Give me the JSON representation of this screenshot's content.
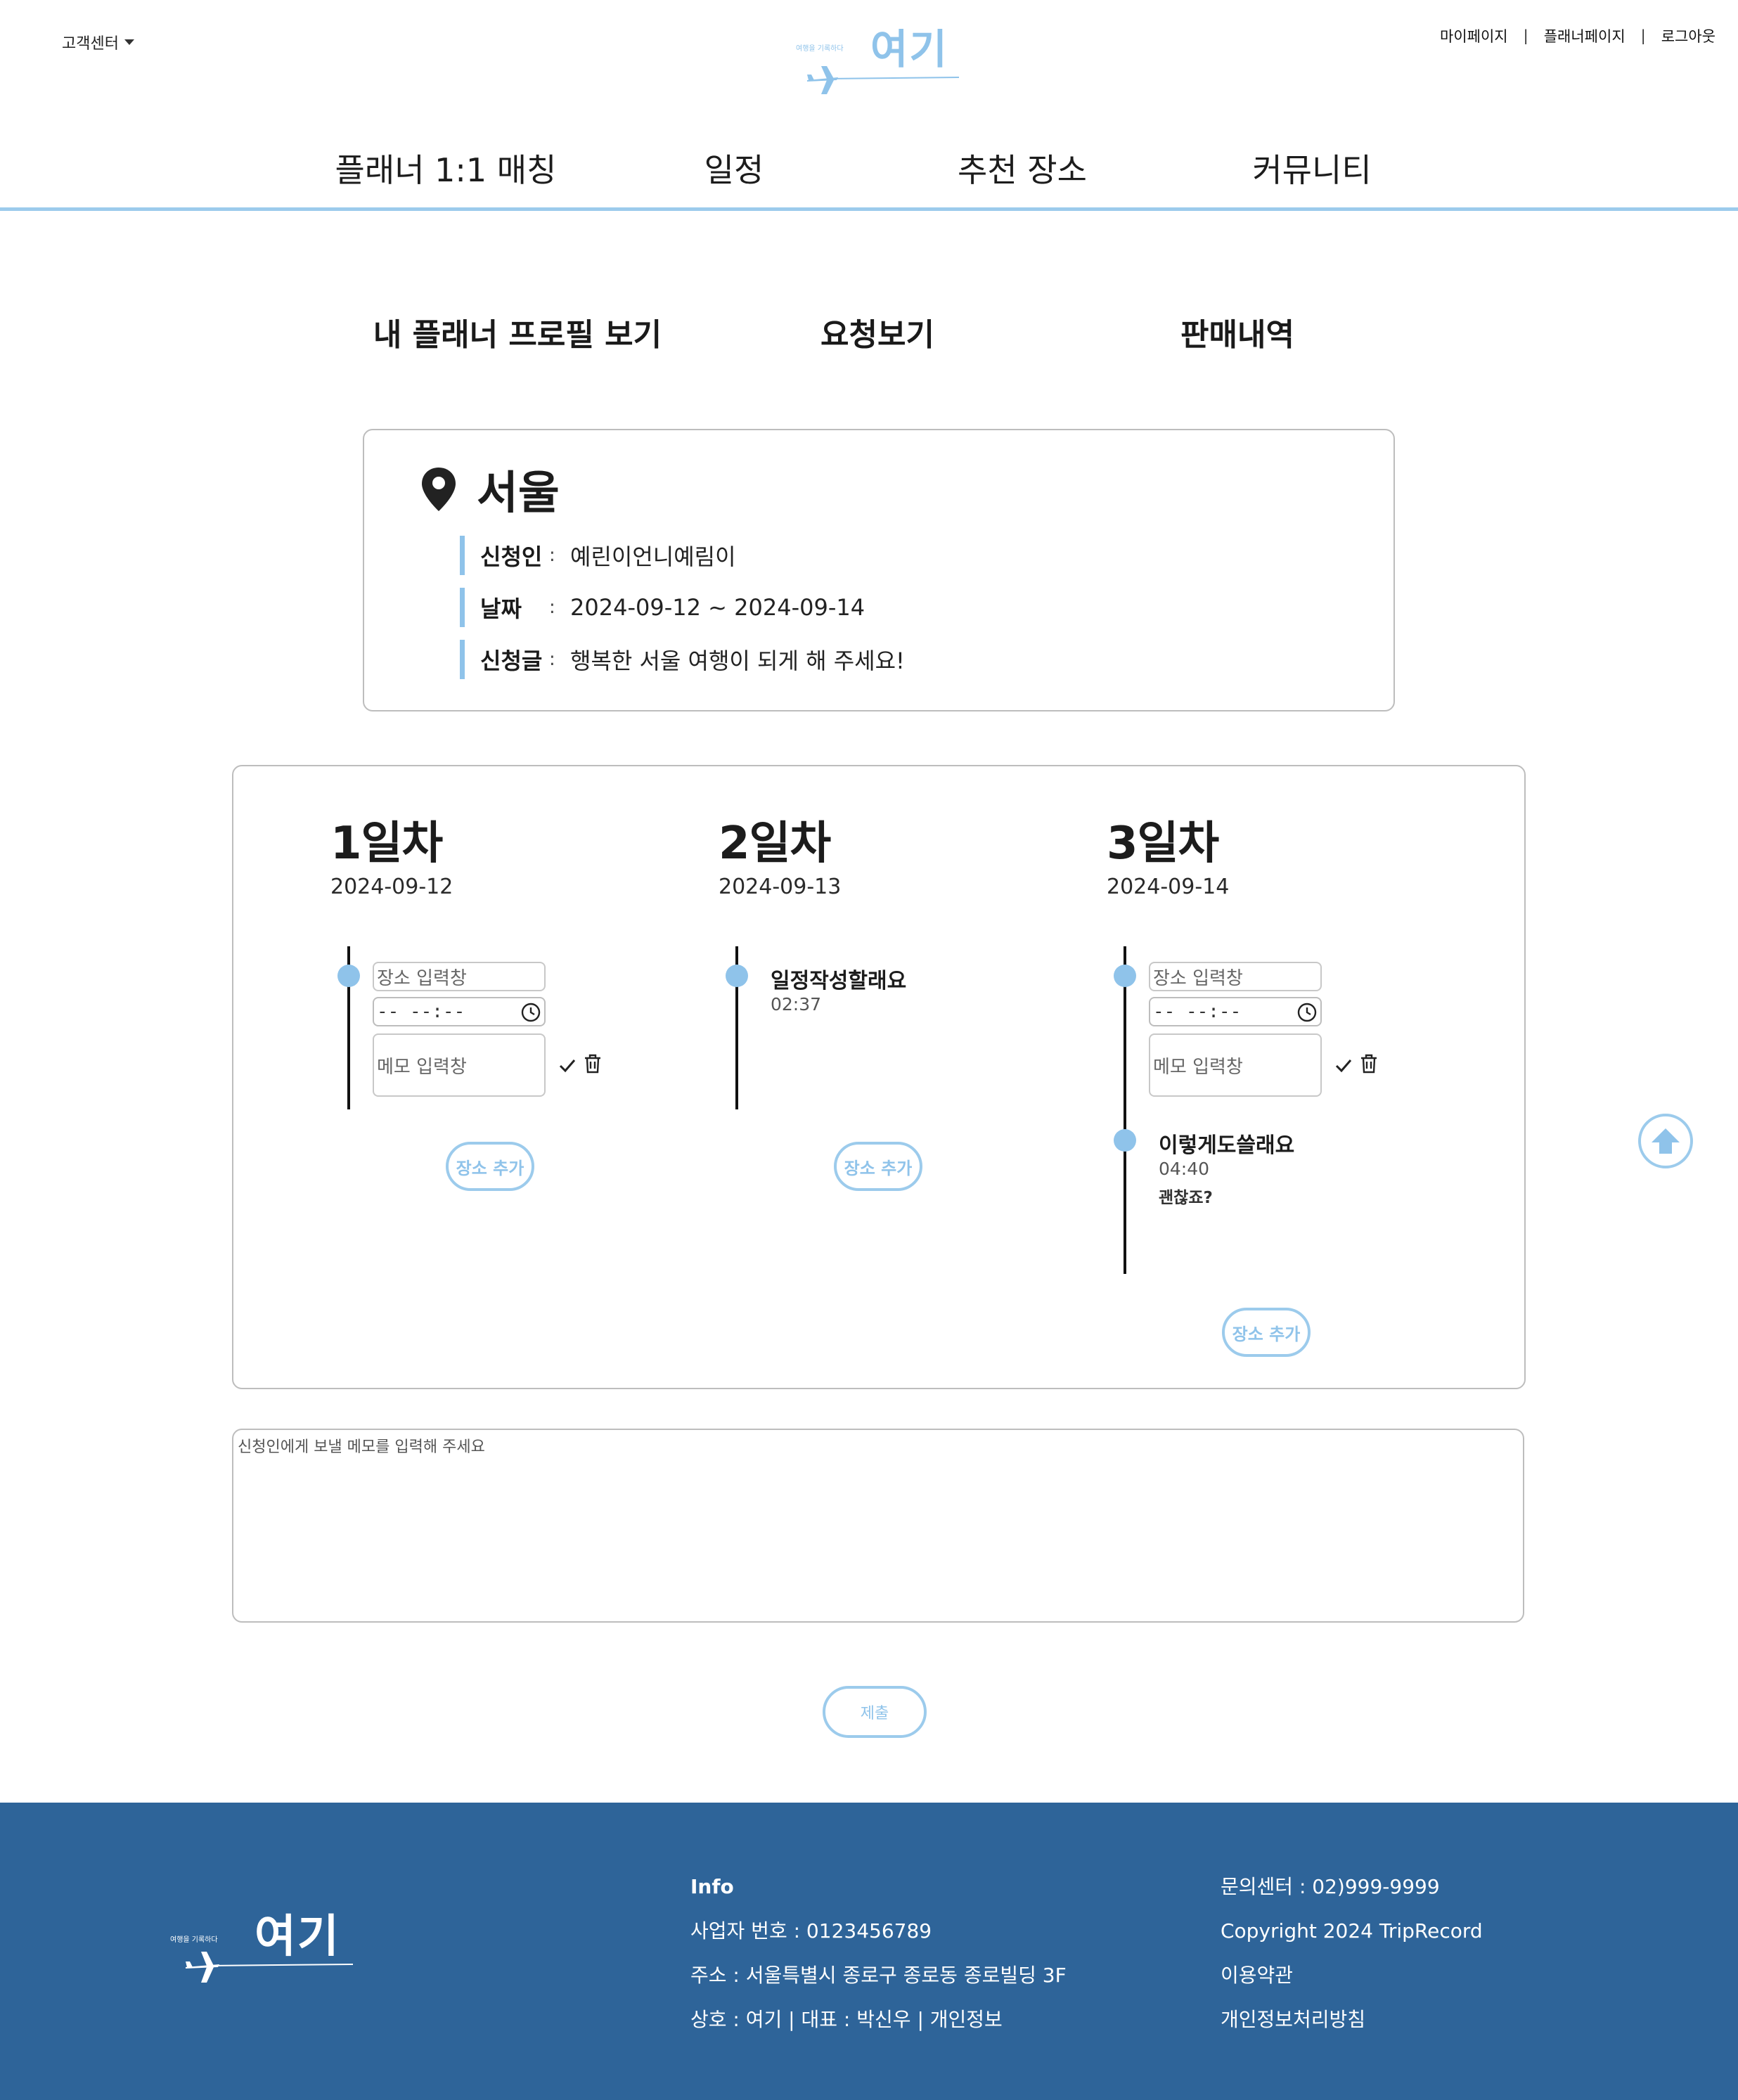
{
  "header": {
    "customer_center": "고객센터",
    "links": [
      "마이페이지",
      "플래너페이지",
      "로그아웃"
    ],
    "separator": "|",
    "logo_tagline": "여행을 기록하다",
    "logo_text": "여기"
  },
  "gnb": [
    "플래너 1:1 매칭",
    "일정",
    "추천 장소",
    "커뮤니티"
  ],
  "subnav": [
    "내 플래너 프로필 보기",
    "요청보기",
    "판매내역"
  ],
  "request": {
    "city": "서울",
    "colon": ":",
    "rows": [
      {
        "label": "신청인",
        "value": "예린이언니예림이"
      },
      {
        "label": "날짜",
        "value": "2024-09-12 ~ 2024-09-14"
      },
      {
        "label": "신청글",
        "value": "행복한 서울 여행이 되게 해 주세요!"
      }
    ]
  },
  "schedule": {
    "place_placeholder": "장소 입력창",
    "time_placeholder": "-- --:--",
    "memo_placeholder": "메모 입력창",
    "add_button": "장소 추가",
    "days": [
      {
        "title": "1일차",
        "date": "2024-09-12"
      },
      {
        "title": "2일차",
        "date": "2024-09-13",
        "entry": {
          "title": "일정작성할래요",
          "time": "02:37"
        }
      },
      {
        "title": "3일차",
        "date": "2024-09-14",
        "entry": {
          "title": "이렇게도쓸래요",
          "time": "04:40",
          "memo": "괜찮죠?"
        }
      }
    ]
  },
  "memo": {
    "placeholder": "신청인에게 보낼 메모를 입력해 주세요"
  },
  "submit_label": "제출",
  "footer": {
    "logo_tagline": "여행을 기록하다",
    "logo_text": "여기",
    "info": [
      "Info",
      "사업자 번호 : 0123456789",
      "주소 : 서울특별시 종로구 종로동 종로빌딩 3F",
      "상호 : 여기 | 대표 : 박신우 | 개인정보"
    ],
    "contact": [
      "문의센터 : 02)999-9999",
      "Copyright 2024 TripRecord",
      "이용약관",
      "개인정보처리방침"
    ]
  },
  "colors": {
    "accent": "#9ccbec",
    "dot": "#8fc3ea",
    "footer_bg": "#2e6499"
  },
  "icons": [
    "caret-down-icon",
    "airplane-icon",
    "location-pin-icon",
    "clock-icon",
    "check-icon",
    "trash-icon",
    "arrow-up-icon"
  ]
}
